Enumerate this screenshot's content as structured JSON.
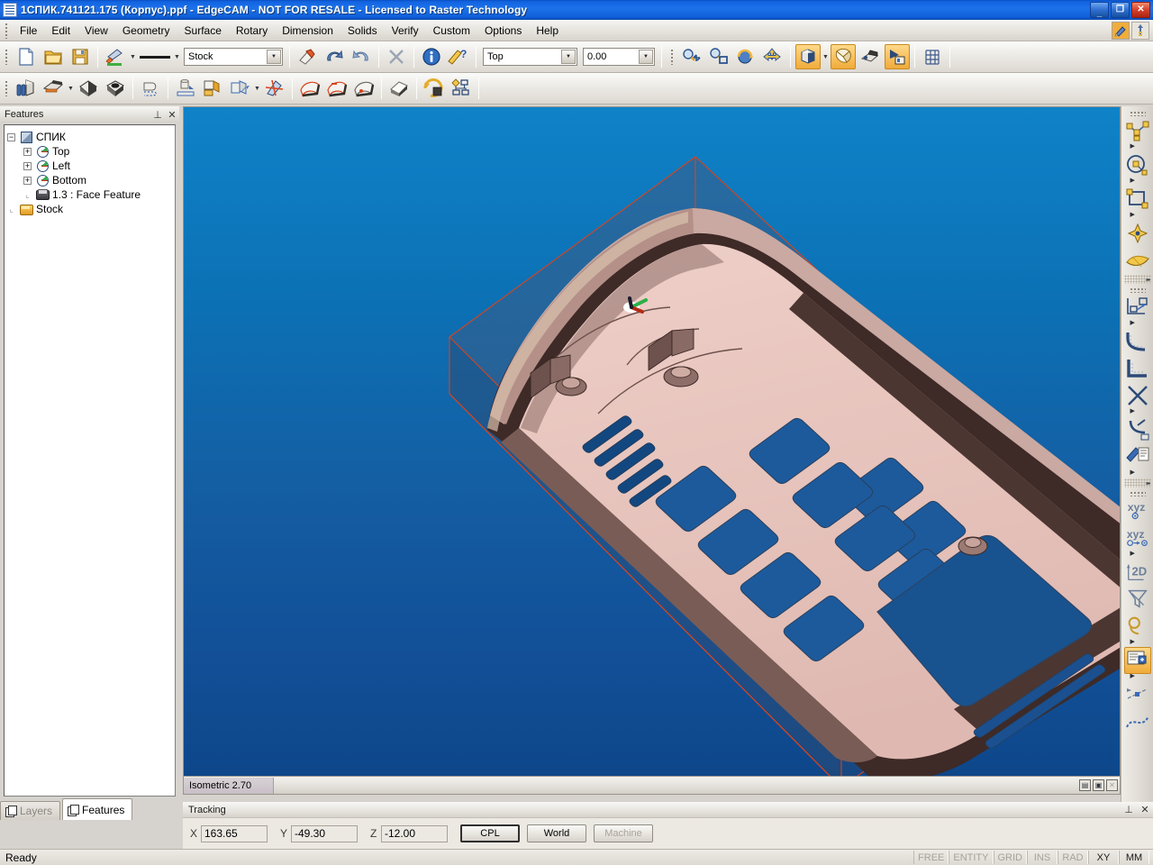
{
  "window": {
    "title": "1СПИК.741121.175 (Корпус).ppf - EdgeCAM - NOT FOR RESALE - Licensed to Raster Technology",
    "app_icon": "document-icon",
    "minimize_label": "_",
    "restore_label": "❐",
    "close_label": "✕"
  },
  "menu": {
    "items": [
      {
        "label": "File"
      },
      {
        "label": "Edit"
      },
      {
        "label": "View"
      },
      {
        "label": "Geometry"
      },
      {
        "label": "Surface"
      },
      {
        "label": "Rotary"
      },
      {
        "label": "Dimension"
      },
      {
        "label": "Solids"
      },
      {
        "label": "Verify"
      },
      {
        "label": "Custom"
      },
      {
        "label": "Options"
      },
      {
        "label": "Help"
      }
    ],
    "right_icons": [
      {
        "name": "edit-pencil-icon"
      },
      {
        "name": "key-icon"
      }
    ]
  },
  "toolbar_main": {
    "buttons": [
      {
        "name": "new-file-icon",
        "label": "New"
      },
      {
        "name": "open-file-icon",
        "label": "Open"
      },
      {
        "name": "save-file-icon",
        "label": "Save"
      },
      {
        "name": "color-picker-icon",
        "label": "Colour"
      },
      {
        "name": "line-style-icon",
        "label": "Line Style"
      }
    ],
    "layer_combo": {
      "name": "layer-combo",
      "value": "Stock"
    },
    "buttons2": [
      {
        "name": "eraser-icon",
        "label": "Clear"
      },
      {
        "name": "undo-icon",
        "label": "Undo"
      },
      {
        "name": "redo-icon",
        "label": "Redo"
      },
      {
        "name": "delete-icon",
        "label": "Delete"
      },
      {
        "name": "info-icon",
        "label": "Info"
      },
      {
        "name": "measure-help-icon",
        "label": "Measure"
      }
    ],
    "view_combo": {
      "name": "view-combo",
      "value": "Top"
    },
    "depth_combo": {
      "name": "depth-combo",
      "value": "0.00"
    },
    "buttons3": [
      {
        "name": "zoom-dynamic-icon",
        "label": "Dynamic Zoom"
      },
      {
        "name": "zoom-window-icon",
        "label": "Zoom Window"
      },
      {
        "name": "rotate-dynamic-icon",
        "label": "Dynamic Rotate"
      },
      {
        "name": "pan-icon",
        "label": "Pan"
      },
      {
        "name": "shaded-view-icon",
        "label": "Shaded"
      },
      {
        "name": "section-view-icon",
        "label": "Section"
      },
      {
        "name": "render-view-icon",
        "label": "Render"
      },
      {
        "name": "viewport-layout-icon",
        "label": "Viewports"
      },
      {
        "name": "grid-icon",
        "label": "Grid"
      }
    ]
  },
  "toolbar_solids": {
    "buttons": [
      {
        "name": "solid-extract-icon",
        "label": "Extract"
      },
      {
        "name": "solid-feature-icon",
        "label": "Feature Find"
      },
      {
        "name": "solid-shell-icon",
        "label": "Shell"
      },
      {
        "name": "solid-pocket-icon",
        "label": "Pocket"
      },
      {
        "name": "solid-profile-icon",
        "label": "Profile"
      },
      {
        "name": "solid-boss-icon",
        "label": "Boss"
      },
      {
        "name": "solid-hole-icon",
        "label": "Hole"
      },
      {
        "name": "solid-transform-icon",
        "label": "Transform"
      },
      {
        "name": "solid-sweep-icon",
        "label": "Sweep"
      },
      {
        "name": "solid-face-a-icon",
        "label": "Face A"
      },
      {
        "name": "solid-face-b-icon",
        "label": "Face B"
      },
      {
        "name": "solid-face-c-icon",
        "label": "Face C"
      },
      {
        "name": "solid-face-d-icon",
        "label": "Face D"
      },
      {
        "name": "solid-rotate-icon",
        "label": "Rotate Solid"
      },
      {
        "name": "feature-tree-icon",
        "label": "Feature Tree"
      }
    ]
  },
  "features_panel": {
    "title": "Features",
    "pin_label": "⊥",
    "close_label": "✕",
    "tree": [
      {
        "label": "СПИК",
        "icon": "cube-icon",
        "expander": "−",
        "depth": 0
      },
      {
        "label": "Top",
        "icon": "cplane-icon",
        "expander": "+",
        "depth": 1
      },
      {
        "label": "Left",
        "icon": "cplane-icon",
        "expander": "+",
        "depth": 1
      },
      {
        "label": "Bottom",
        "icon": "cplane-icon",
        "expander": "+",
        "depth": 1
      },
      {
        "label": "1.3 :  Face Feature",
        "icon": "face-feature-icon",
        "expander": "",
        "depth": 1
      },
      {
        "label": "Stock",
        "icon": "stock-icon",
        "expander": "",
        "depth": 0
      }
    ],
    "tabs": [
      {
        "label": "Layers",
        "selected": false,
        "icon": "layers-icon"
      },
      {
        "label": "Features",
        "selected": true,
        "icon": "features-icon"
      }
    ]
  },
  "viewport": {
    "view_label": "Isometric 2.70",
    "window_controls": [
      {
        "name": "restore-down-icon",
        "label": "▤",
        "disabled": false
      },
      {
        "name": "maximize-icon",
        "label": "▣",
        "disabled": false
      },
      {
        "name": "close-view-icon",
        "label": "✕",
        "disabled": true
      }
    ],
    "axis_triad": "axis-triad-icon",
    "colors": {
      "background_top": "#0f7fc4",
      "background_bottom": "#0f4a8e",
      "stock_wireframe": "#d84a1e",
      "part_light": "#e8c3bc",
      "part_shadow": "#4a3330",
      "pocket_fill": "#1b5a9e"
    }
  },
  "tracking": {
    "title": "Tracking",
    "pin_label": "⊥",
    "close_label": "✕",
    "coordinates": [
      {
        "axis": "X",
        "value": "163.65"
      },
      {
        "axis": "Y",
        "value": "-49.30"
      },
      {
        "axis": "Z",
        "value": "-12.00"
      }
    ],
    "buttons": [
      {
        "label": "CPL",
        "state": "focus"
      },
      {
        "label": "World",
        "state": "selected"
      },
      {
        "label": "Machine",
        "state": "disabled"
      }
    ]
  },
  "statusbar": {
    "message": "Ready",
    "indicators": [
      {
        "label": "FREE",
        "active": false
      },
      {
        "label": "ENTITY",
        "active": false
      },
      {
        "label": "GRID",
        "active": false
      },
      {
        "label": "INS",
        "active": false
      },
      {
        "label": "RAD",
        "active": false
      },
      {
        "label": "XY",
        "active": true
      },
      {
        "label": "MM",
        "active": true
      }
    ]
  },
  "right_toolbar": {
    "groups": [
      {
        "name": "geometry-group",
        "buttons": [
          {
            "name": "polyline-icon",
            "label": "Polyline",
            "flyout": true,
            "active": false
          },
          {
            "name": "circle-icon",
            "label": "Circle",
            "flyout": true,
            "active": false
          },
          {
            "name": "rectangle-icon",
            "label": "Rectangle",
            "flyout": true,
            "active": false
          },
          {
            "name": "point-icon",
            "label": "Point",
            "flyout": false,
            "active": false
          },
          {
            "name": "surface-icon",
            "label": "Surface",
            "flyout": false,
            "active": false
          }
        ]
      },
      {
        "name": "modify-group",
        "buttons": [
          {
            "name": "move-copy-icon",
            "label": "Move / Copy",
            "flyout": true,
            "active": false
          },
          {
            "name": "fillet-icon",
            "label": "Fillet",
            "flyout": false,
            "active": false
          },
          {
            "name": "corner-icon",
            "label": "Corner",
            "flyout": false,
            "active": false
          },
          {
            "name": "trim-icon",
            "label": "Trim",
            "flyout": true,
            "active": false
          },
          {
            "name": "break-icon",
            "label": "Break",
            "flyout": false,
            "active": false
          },
          {
            "name": "text-note-icon",
            "label": "Text / Note",
            "flyout": true,
            "active": false
          }
        ]
      },
      {
        "name": "cpl-group",
        "buttons": [
          {
            "name": "xyz-origin-icon",
            "label": "xyz",
            "flyout": false,
            "active": false
          },
          {
            "name": "xyz-move-origin-icon",
            "label": "xyz",
            "flyout": true,
            "active": false
          },
          {
            "name": "cpl-2d-icon",
            "label": "2D",
            "flyout": false,
            "active": false
          },
          {
            "name": "cpl-view-icon",
            "label": "CPL View",
            "flyout": false,
            "active": false
          },
          {
            "name": "magnifier-icon",
            "label": "Inspect",
            "flyout": true,
            "active": false
          },
          {
            "name": "layers-manager-icon",
            "label": "Layers",
            "flyout": true,
            "active": true
          },
          {
            "name": "datum-icon",
            "label": "Datum",
            "flyout": false,
            "active": false
          },
          {
            "name": "spline-icon",
            "label": "Spline",
            "flyout": false,
            "active": false
          }
        ]
      }
    ]
  }
}
